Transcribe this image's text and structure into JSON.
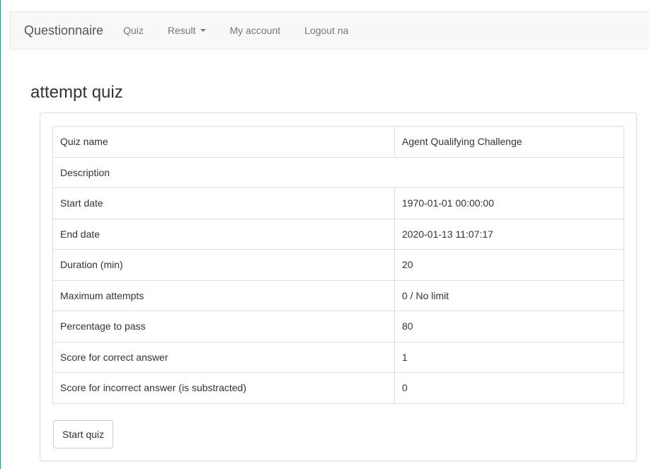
{
  "navbar": {
    "brand": "Questionnaire",
    "items": [
      {
        "label": "Quiz"
      },
      {
        "label": "Result"
      },
      {
        "label": "My account"
      },
      {
        "label": "Logout na"
      }
    ]
  },
  "page": {
    "title": "attempt quiz"
  },
  "quiz_info": {
    "rows": [
      {
        "label": "Quiz name",
        "value": "Agent Qualifying Challenge"
      },
      {
        "label": "Description",
        "value": ""
      },
      {
        "label": "Start date",
        "value": "1970-01-01 00:00:00"
      },
      {
        "label": "End date",
        "value": "2020-01-13 11:07:17"
      },
      {
        "label": "Duration (min)",
        "value": "20"
      },
      {
        "label": "Maximum attempts",
        "value": "0 / No limit"
      },
      {
        "label": "Percentage to pass",
        "value": "80"
      },
      {
        "label": "Score for correct answer",
        "value": "1"
      },
      {
        "label": "Score for incorrect answer (is substracted)",
        "value": "0"
      }
    ]
  },
  "actions": {
    "start_label": "Start quiz"
  }
}
